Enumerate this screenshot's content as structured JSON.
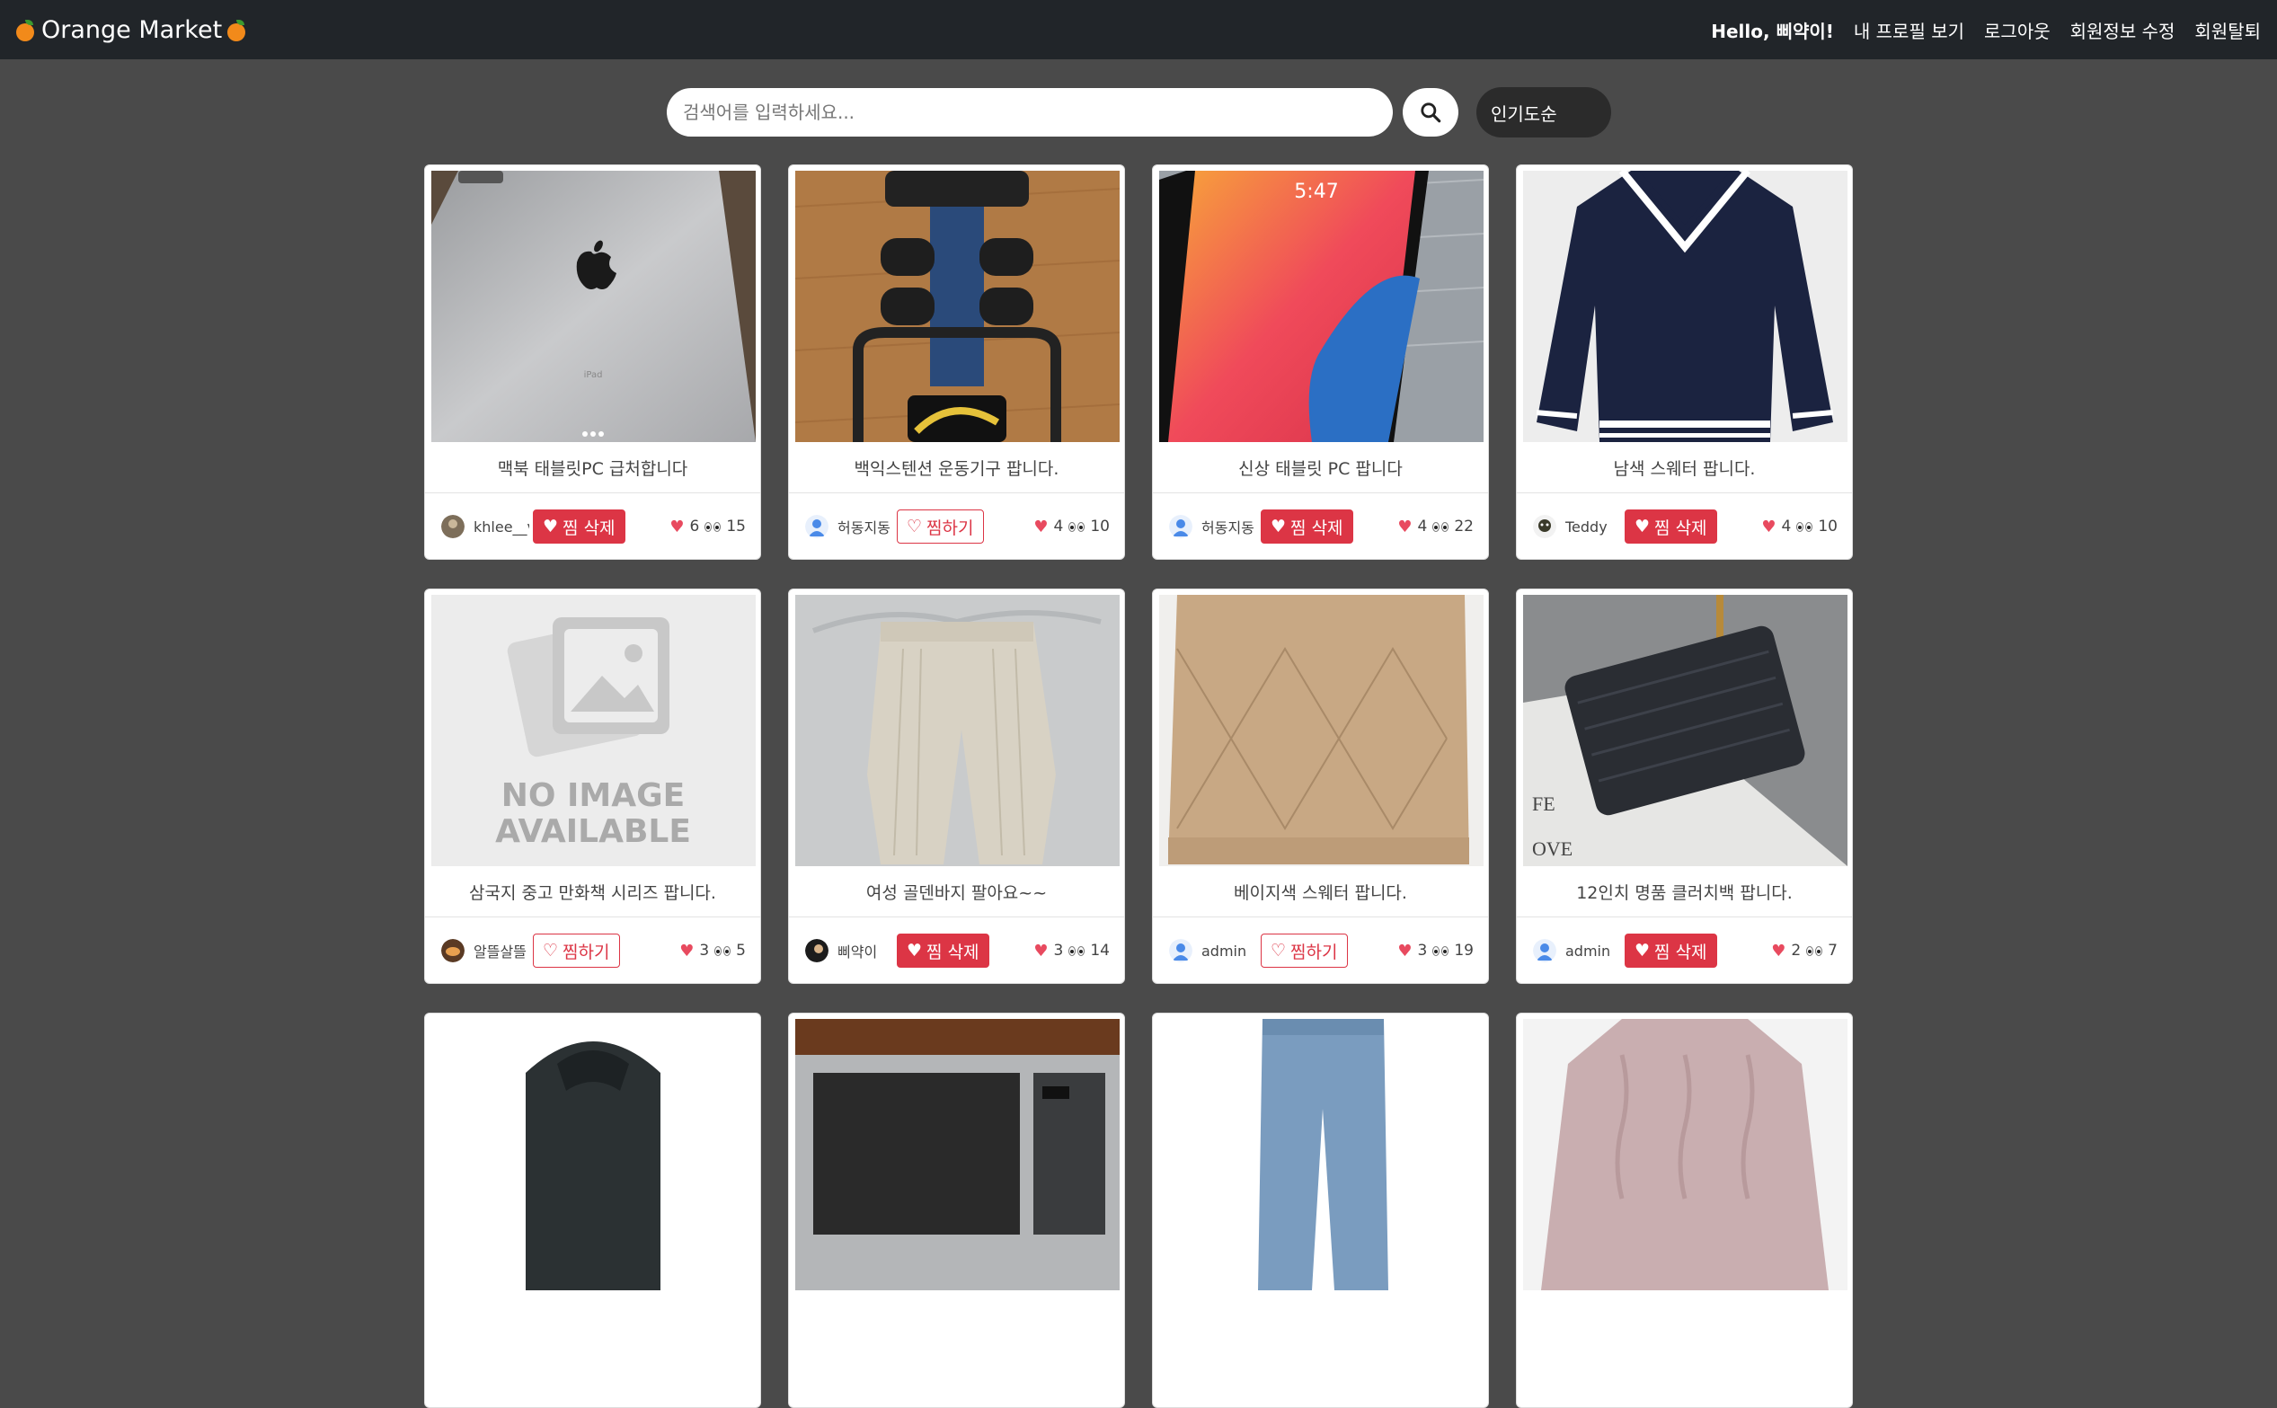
{
  "nav": {
    "brand": "Orange Market",
    "hello": "Hello, 삐약이!",
    "links": [
      "내 프로필 보기",
      "로그아웃",
      "회원정보 수정",
      "회원탈퇴"
    ]
  },
  "search": {
    "placeholder": "검색어를 입력하세요...",
    "sort_label": "인기도순"
  },
  "products": [
    {
      "title": "맥북 태블릿PC 급처합니다",
      "seller": "khlee__v",
      "like_label": "찜 삭제",
      "liked": true,
      "likes": "6",
      "views": "15"
    },
    {
      "title": "백익스텐션 운동기구 팝니다.",
      "seller": "허동지동",
      "like_label": "찜하기",
      "liked": false,
      "likes": "4",
      "views": "10"
    },
    {
      "title": "신상 태블릿 PC 팝니다",
      "seller": "허동지동",
      "like_label": "찜 삭제",
      "liked": true,
      "likes": "4",
      "views": "22"
    },
    {
      "title": "남색 스웨터 팝니다.",
      "seller": "Teddy",
      "like_label": "찜 삭제",
      "liked": true,
      "likes": "4",
      "views": "10"
    },
    {
      "title": "삼국지 중고 만화책 시리즈 팝니다.",
      "seller": "알뜰살뜰",
      "like_label": "찜하기",
      "liked": false,
      "likes": "3",
      "views": "5"
    },
    {
      "title": "여성 골덴바지 팔아요~~",
      "seller": "삐약이",
      "like_label": "찜 삭제",
      "liked": true,
      "likes": "3",
      "views": "14"
    },
    {
      "title": "베이지색 스웨터 팝니다.",
      "seller": "admin",
      "like_label": "찜하기",
      "liked": false,
      "likes": "3",
      "views": "19"
    },
    {
      "title": "12인치 명품 클러치백 팝니다.",
      "seller": "admin",
      "like_label": "찜 삭제",
      "liked": true,
      "likes": "2",
      "views": "7"
    },
    {
      "title": "",
      "seller": "",
      "like_label": "",
      "liked": false,
      "likes": "",
      "views": ""
    },
    {
      "title": "",
      "seller": "",
      "like_label": "",
      "liked": false,
      "likes": "",
      "views": ""
    },
    {
      "title": "",
      "seller": "",
      "like_label": "",
      "liked": false,
      "likes": "",
      "views": ""
    },
    {
      "title": "",
      "seller": "",
      "like_label": "",
      "liked": false,
      "likes": "",
      "views": ""
    }
  ],
  "no_image": {
    "line1": "NO IMAGE",
    "line2": "AVAILABLE"
  },
  "colors": {
    "accent": "#dc3545",
    "nav": "#212529",
    "background": "#4a4a4a"
  }
}
